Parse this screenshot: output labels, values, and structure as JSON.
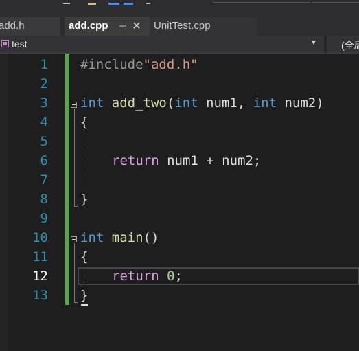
{
  "tabs": [
    {
      "label": "add.h"
    },
    {
      "label": "add.cpp",
      "active": true
    },
    {
      "label": "UnitTest.cpp"
    }
  ],
  "tab_pin_glyph": "⊣",
  "tab_close_glyph": "✕",
  "navbar": {
    "scope": "test",
    "right_scope": "(全局"
  },
  "editor": {
    "current_line": 12,
    "line_numbers": [
      "1",
      "2",
      "3",
      "4",
      "5",
      "6",
      "7",
      "8",
      "9",
      "10",
      "11",
      "12",
      "13"
    ],
    "code": {
      "l1": {
        "directive": "#include",
        "file": "\"add.h\""
      },
      "l3": {
        "type": "int",
        "func": "add_two",
        "open": "(",
        "t1": "int",
        "p1": " num1, ",
        "t2": "int",
        "p2": " num2)"
      },
      "l4": {
        "text": "{"
      },
      "l6": {
        "kw": "return",
        "rest": " num1 + num2;"
      },
      "l8": {
        "text": "}"
      },
      "l10": {
        "type": "int",
        "func": "main",
        "rest": "()"
      },
      "l11": {
        "text": "{"
      },
      "l12": {
        "kw": "return",
        "sp": " ",
        "num": "0",
        "semi": ";"
      },
      "l13": {
        "text": "}"
      }
    }
  },
  "colors": {
    "keyword": "#569cd6",
    "return": "#d8a0df",
    "function": "#dcdcaa",
    "string": "#d69d85",
    "number": "#b5cea8",
    "change_bar": "#57a64a"
  }
}
